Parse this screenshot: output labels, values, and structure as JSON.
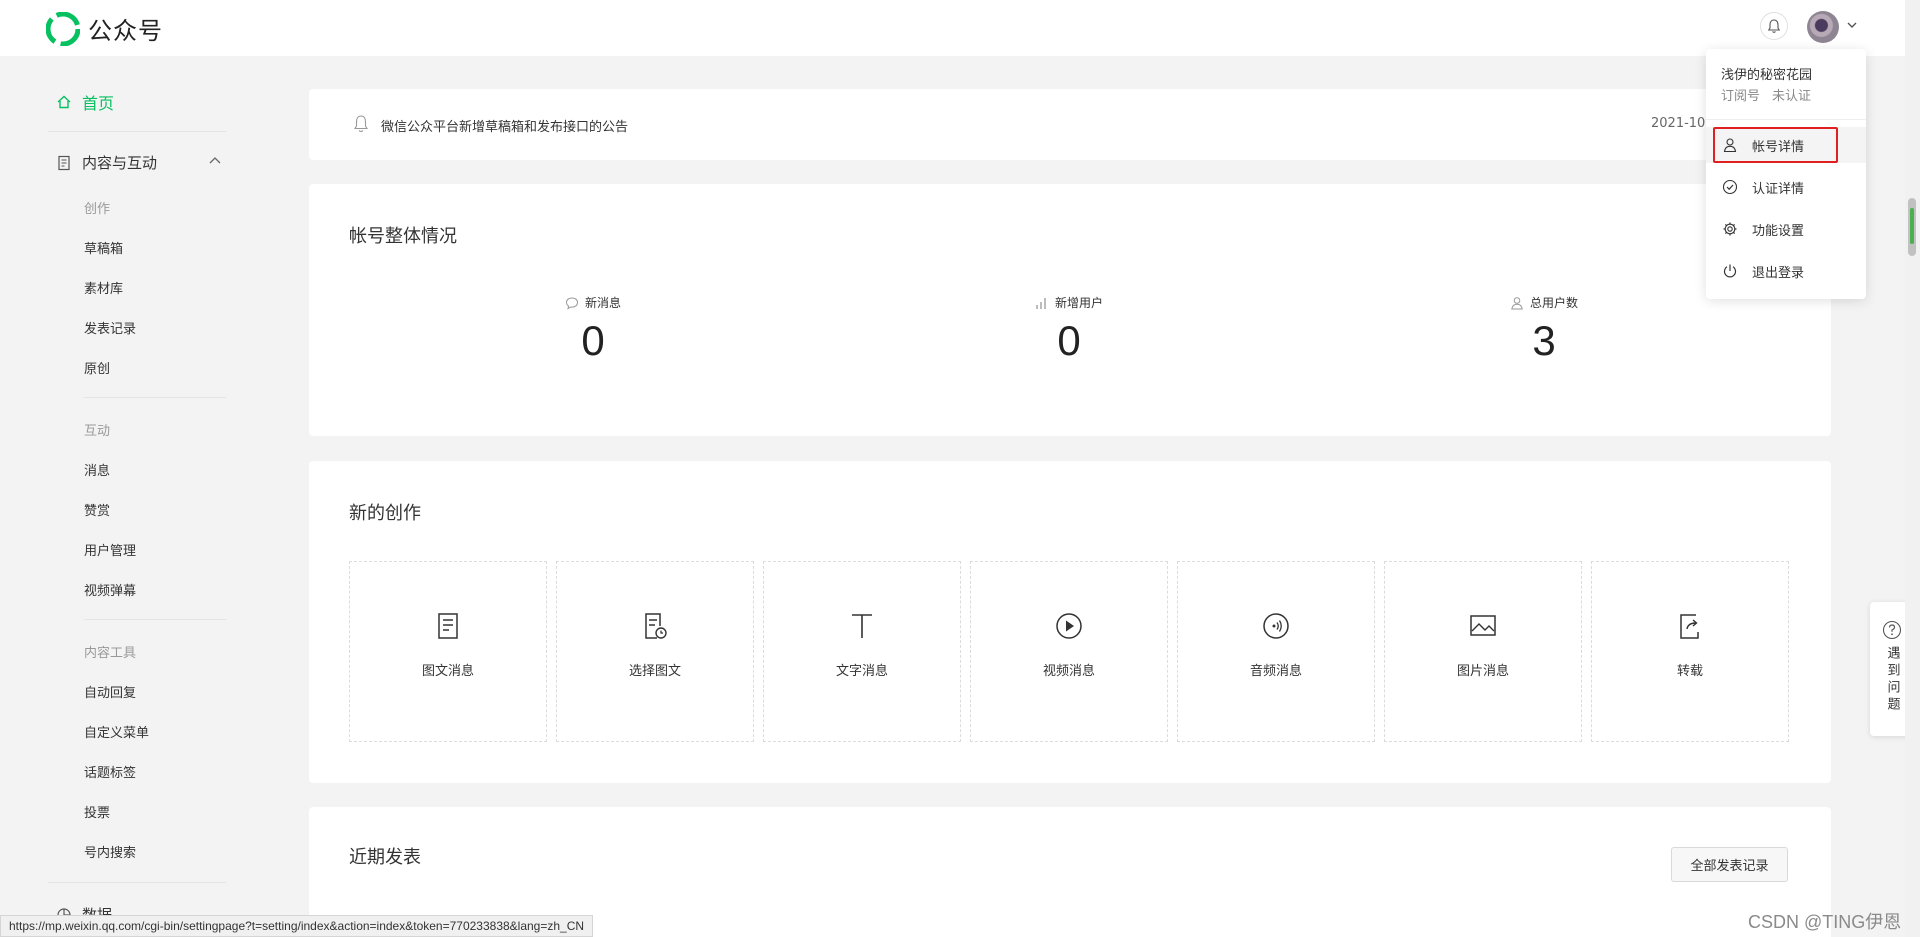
{
  "app": {
    "name": "公众号",
    "brand_color": "#07c160"
  },
  "sidebar": {
    "home": "首页",
    "group_content": "内容与互动",
    "section_creation": "创作",
    "creation_items": [
      "草稿箱",
      "素材库",
      "发表记录",
      "原创"
    ],
    "section_interaction": "互动",
    "interaction_items": [
      "消息",
      "赞赏",
      "用户管理",
      "视频弹幕"
    ],
    "section_tools": "内容工具",
    "tools_items": [
      "自动回复",
      "自定义菜单",
      "话题标签",
      "投票",
      "号内搜索"
    ],
    "group_data": "数据"
  },
  "notice": {
    "text": "微信公众平台新增草稿箱和发布接口的公告",
    "date": "2021-10"
  },
  "overview": {
    "title": "帐号整体情况",
    "stats": [
      {
        "label": "新消息",
        "value": "0",
        "icon": "chat-bubble-icon"
      },
      {
        "label": "新增用户",
        "value": "0",
        "icon": "bar-chart-icon"
      },
      {
        "label": "总用户数",
        "value": "3",
        "icon": "user-icon"
      }
    ]
  },
  "creation": {
    "title": "新的创作",
    "items": [
      {
        "label": "图文消息",
        "icon": "document-icon"
      },
      {
        "label": "选择图文",
        "icon": "select-document-icon"
      },
      {
        "label": "文字消息",
        "icon": "text-icon"
      },
      {
        "label": "视频消息",
        "icon": "play-icon"
      },
      {
        "label": "音频消息",
        "icon": "audio-icon"
      },
      {
        "label": "图片消息",
        "icon": "image-icon"
      },
      {
        "label": "转载",
        "icon": "repost-icon"
      }
    ]
  },
  "recent": {
    "title": "近期发表",
    "all_button": "全部发表记录"
  },
  "account_menu": {
    "name": "浅伊的秘密花园",
    "type": "订阅号",
    "verify": "未认证",
    "items": [
      {
        "label": "帐号详情",
        "icon": "user-icon",
        "highlighted": true
      },
      {
        "label": "认证详情",
        "icon": "check-circle-icon"
      },
      {
        "label": "功能设置",
        "icon": "gear-icon"
      },
      {
        "label": "退出登录",
        "icon": "power-icon"
      }
    ]
  },
  "help": {
    "label": "遇到问题"
  },
  "status_url": "https://mp.weixin.qq.com/cgi-bin/settingpage?t=setting/index&action=index&token=770233838&lang=zh_CN",
  "watermark": "CSDN @TING伊恩"
}
